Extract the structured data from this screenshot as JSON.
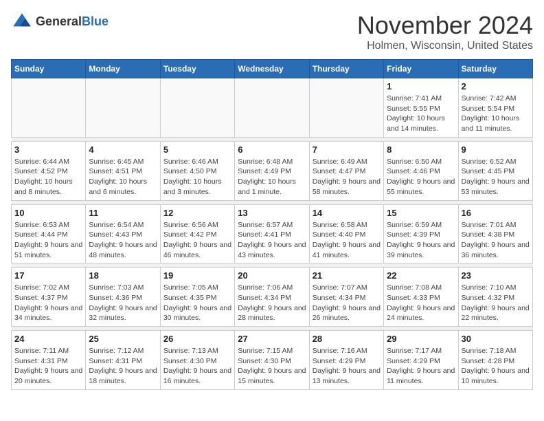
{
  "header": {
    "logo_general": "General",
    "logo_blue": "Blue",
    "month_title": "November 2024",
    "location": "Holmen, Wisconsin, United States"
  },
  "days_of_week": [
    "Sunday",
    "Monday",
    "Tuesday",
    "Wednesday",
    "Thursday",
    "Friday",
    "Saturday"
  ],
  "weeks": [
    [
      {
        "day": "",
        "info": ""
      },
      {
        "day": "",
        "info": ""
      },
      {
        "day": "",
        "info": ""
      },
      {
        "day": "",
        "info": ""
      },
      {
        "day": "",
        "info": ""
      },
      {
        "day": "1",
        "info": "Sunrise: 7:41 AM\nSunset: 5:55 PM\nDaylight: 10 hours and 14 minutes."
      },
      {
        "day": "2",
        "info": "Sunrise: 7:42 AM\nSunset: 5:54 PM\nDaylight: 10 hours and 11 minutes."
      }
    ],
    [
      {
        "day": "3",
        "info": "Sunrise: 6:44 AM\nSunset: 4:52 PM\nDaylight: 10 hours and 8 minutes."
      },
      {
        "day": "4",
        "info": "Sunrise: 6:45 AM\nSunset: 4:51 PM\nDaylight: 10 hours and 6 minutes."
      },
      {
        "day": "5",
        "info": "Sunrise: 6:46 AM\nSunset: 4:50 PM\nDaylight: 10 hours and 3 minutes."
      },
      {
        "day": "6",
        "info": "Sunrise: 6:48 AM\nSunset: 4:49 PM\nDaylight: 10 hours and 1 minute."
      },
      {
        "day": "7",
        "info": "Sunrise: 6:49 AM\nSunset: 4:47 PM\nDaylight: 9 hours and 58 minutes."
      },
      {
        "day": "8",
        "info": "Sunrise: 6:50 AM\nSunset: 4:46 PM\nDaylight: 9 hours and 55 minutes."
      },
      {
        "day": "9",
        "info": "Sunrise: 6:52 AM\nSunset: 4:45 PM\nDaylight: 9 hours and 53 minutes."
      }
    ],
    [
      {
        "day": "10",
        "info": "Sunrise: 6:53 AM\nSunset: 4:44 PM\nDaylight: 9 hours and 51 minutes."
      },
      {
        "day": "11",
        "info": "Sunrise: 6:54 AM\nSunset: 4:43 PM\nDaylight: 9 hours and 48 minutes."
      },
      {
        "day": "12",
        "info": "Sunrise: 6:56 AM\nSunset: 4:42 PM\nDaylight: 9 hours and 46 minutes."
      },
      {
        "day": "13",
        "info": "Sunrise: 6:57 AM\nSunset: 4:41 PM\nDaylight: 9 hours and 43 minutes."
      },
      {
        "day": "14",
        "info": "Sunrise: 6:58 AM\nSunset: 4:40 PM\nDaylight: 9 hours and 41 minutes."
      },
      {
        "day": "15",
        "info": "Sunrise: 6:59 AM\nSunset: 4:39 PM\nDaylight: 9 hours and 39 minutes."
      },
      {
        "day": "16",
        "info": "Sunrise: 7:01 AM\nSunset: 4:38 PM\nDaylight: 9 hours and 36 minutes."
      }
    ],
    [
      {
        "day": "17",
        "info": "Sunrise: 7:02 AM\nSunset: 4:37 PM\nDaylight: 9 hours and 34 minutes."
      },
      {
        "day": "18",
        "info": "Sunrise: 7:03 AM\nSunset: 4:36 PM\nDaylight: 9 hours and 32 minutes."
      },
      {
        "day": "19",
        "info": "Sunrise: 7:05 AM\nSunset: 4:35 PM\nDaylight: 9 hours and 30 minutes."
      },
      {
        "day": "20",
        "info": "Sunrise: 7:06 AM\nSunset: 4:34 PM\nDaylight: 9 hours and 28 minutes."
      },
      {
        "day": "21",
        "info": "Sunrise: 7:07 AM\nSunset: 4:34 PM\nDaylight: 9 hours and 26 minutes."
      },
      {
        "day": "22",
        "info": "Sunrise: 7:08 AM\nSunset: 4:33 PM\nDaylight: 9 hours and 24 minutes."
      },
      {
        "day": "23",
        "info": "Sunrise: 7:10 AM\nSunset: 4:32 PM\nDaylight: 9 hours and 22 minutes."
      }
    ],
    [
      {
        "day": "24",
        "info": "Sunrise: 7:11 AM\nSunset: 4:31 PM\nDaylight: 9 hours and 20 minutes."
      },
      {
        "day": "25",
        "info": "Sunrise: 7:12 AM\nSunset: 4:31 PM\nDaylight: 9 hours and 18 minutes."
      },
      {
        "day": "26",
        "info": "Sunrise: 7:13 AM\nSunset: 4:30 PM\nDaylight: 9 hours and 16 minutes."
      },
      {
        "day": "27",
        "info": "Sunrise: 7:15 AM\nSunset: 4:30 PM\nDaylight: 9 hours and 15 minutes."
      },
      {
        "day": "28",
        "info": "Sunrise: 7:16 AM\nSunset: 4:29 PM\nDaylight: 9 hours and 13 minutes."
      },
      {
        "day": "29",
        "info": "Sunrise: 7:17 AM\nSunset: 4:29 PM\nDaylight: 9 hours and 11 minutes."
      },
      {
        "day": "30",
        "info": "Sunrise: 7:18 AM\nSunset: 4:28 PM\nDaylight: 9 hours and 10 minutes."
      }
    ]
  ]
}
